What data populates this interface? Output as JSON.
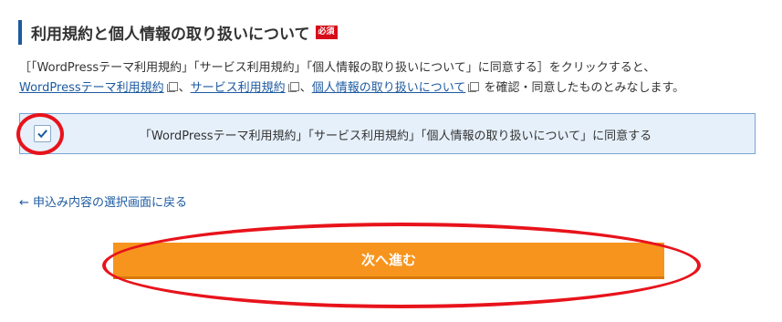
{
  "section": {
    "title": "利用規約と個人情報の取り扱いについて",
    "required_badge": "必須",
    "accent_color": "#1d5aa0",
    "badge_color": "#d70c19"
  },
  "description": {
    "line1": "［「WordPressテーマ利用規約」「サービス利用規約」「個人情報の取り扱いについて」に同意する］をクリックすると、",
    "link_wp_terms": "WordPressテーマ利用規約",
    "sep1": "、",
    "link_service_terms": "サービス利用規約",
    "sep2": "、",
    "link_privacy": "個人情報の取り扱いについて",
    "suffix": "を確認・同意したものとみなします。",
    "link_icon": "external-window-icon"
  },
  "agreement": {
    "checked": true,
    "label": "「WordPressテーマ利用規約」「サービス利用規約」「個人情報の取り扱いについて」に同意する",
    "box_color": "#e6f0fb"
  },
  "back_link": {
    "label": "← 申込み内容の選択画面に戻る"
  },
  "next_button": {
    "label": "次へ進む",
    "color": "#f7941d"
  },
  "annotations": {
    "color": "#e8131b",
    "shape": "oval"
  }
}
